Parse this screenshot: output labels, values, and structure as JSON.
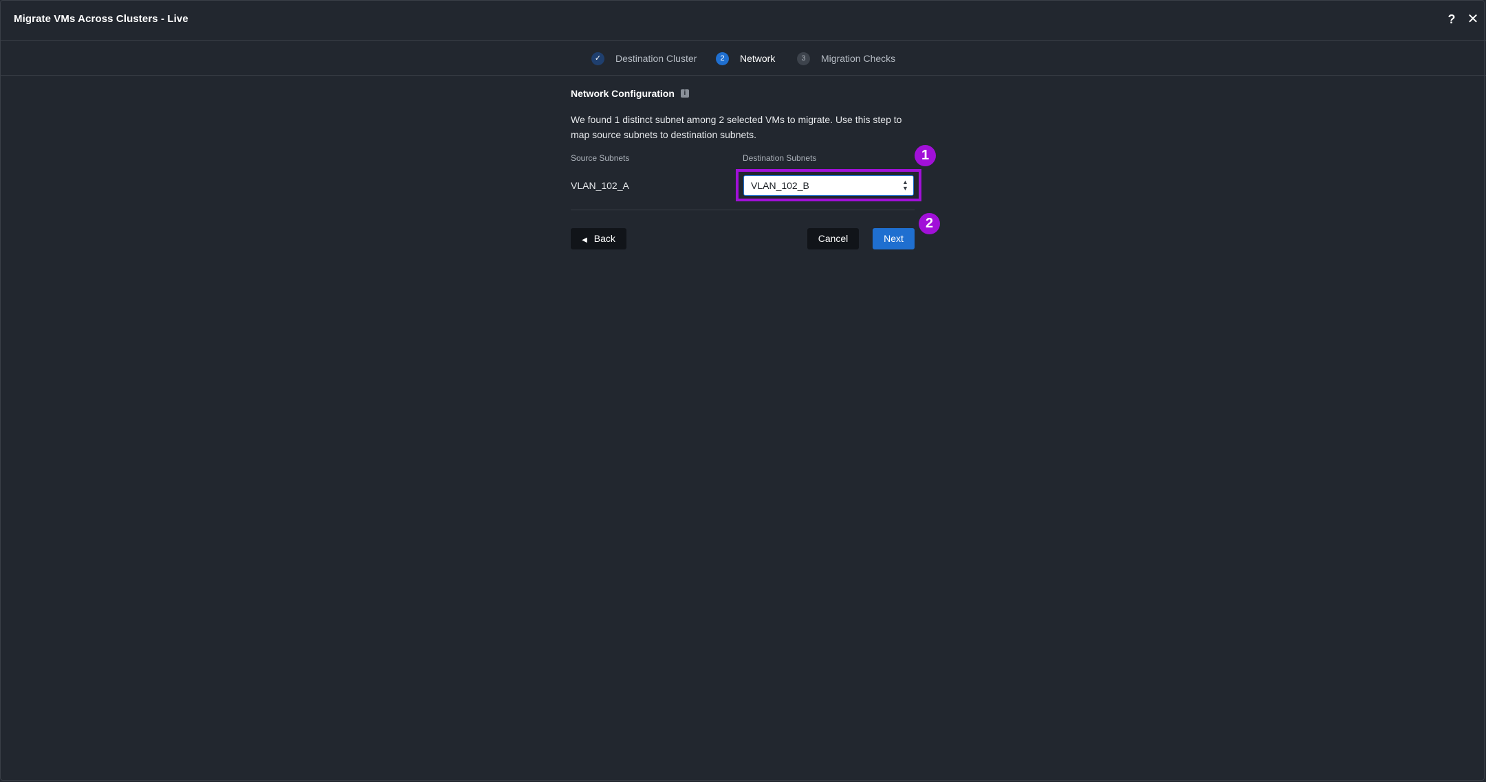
{
  "window": {
    "title": "Migrate VMs Across Clusters - Live",
    "help_label": "?",
    "close_label": "✕"
  },
  "stepper": {
    "steps": [
      {
        "number": "✓",
        "label": "Destination Cluster",
        "state": "completed"
      },
      {
        "number": "2",
        "label": "Network",
        "state": "active"
      },
      {
        "number": "3",
        "label": "Migration Checks",
        "state": "pending"
      }
    ]
  },
  "network": {
    "title": "Network Configuration",
    "info_icon": "i",
    "description": "We found 1 distinct subnet among 2 selected VMs to migrate. Use this step to map source subnets to destination subnets.",
    "source_header": "Source Subnets",
    "destination_header": "Destination Subnets",
    "rows": [
      {
        "source": "VLAN_102_A",
        "destination": "VLAN_102_B"
      }
    ]
  },
  "footer": {
    "back_label": "Back",
    "cancel_label": "Cancel",
    "next_label": "Next"
  },
  "annotations": {
    "marker_1": "1",
    "marker_2": "2"
  },
  "colors": {
    "background": "#22272f",
    "accent": "#1f6fd0",
    "highlight": "#a110d8"
  }
}
